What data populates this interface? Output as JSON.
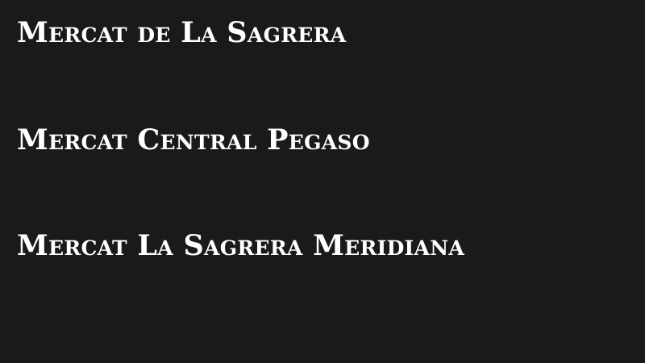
{
  "markets": [
    {
      "name": "Mercat de La Sagrera"
    },
    {
      "name": "Mercat Central Pegaso"
    },
    {
      "name": "Mercat La Sagrera Meridiana"
    }
  ],
  "colors": {
    "background": "#1a1a1c",
    "text": "#ffffff"
  }
}
